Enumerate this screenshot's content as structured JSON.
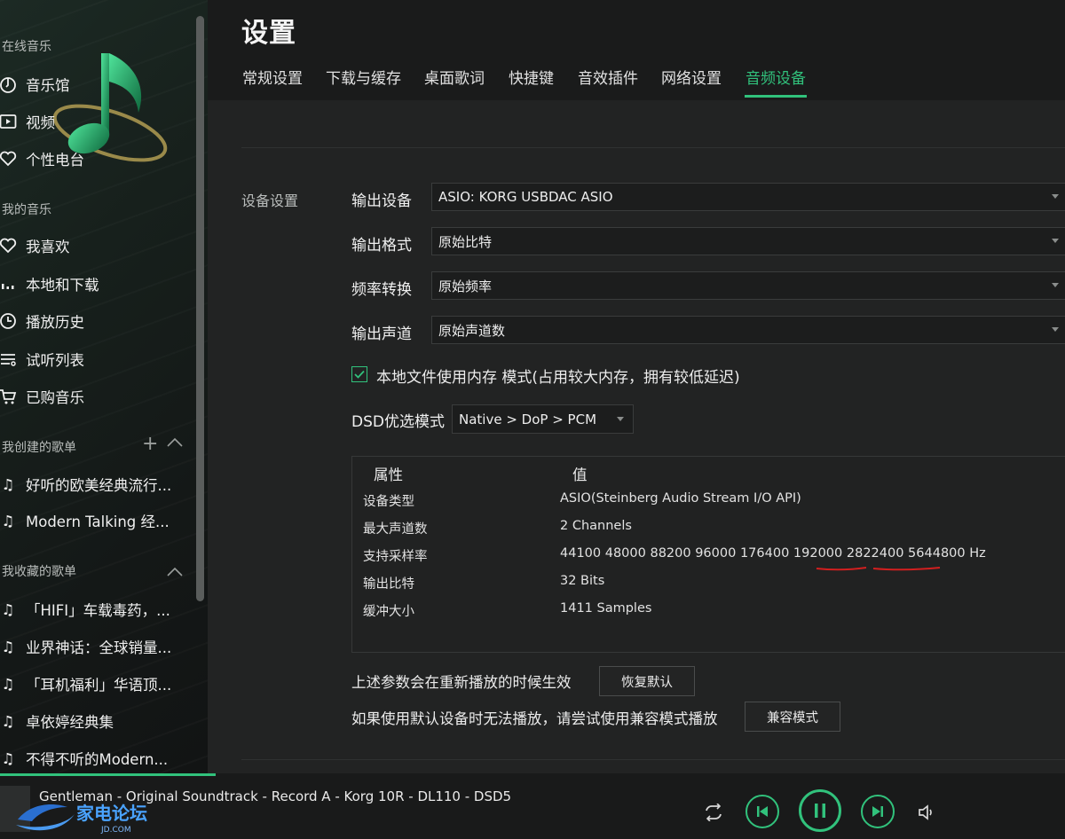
{
  "sidebar": {
    "online_section": "在线音乐",
    "my_music_section": "我的音乐",
    "created_section": "我创建的歌单",
    "collected_section": "我收藏的歌单",
    "online_items": [
      {
        "label": "音乐馆",
        "icon": "music-hall-icon"
      },
      {
        "label": "视频",
        "icon": "video-icon"
      },
      {
        "label": "个性电台",
        "icon": "radio-icon"
      }
    ],
    "my_items": [
      {
        "label": "我喜欢",
        "icon": "heart-icon"
      },
      {
        "label": "本地和下载",
        "icon": "download-bars-icon"
      },
      {
        "label": "播放历史",
        "icon": "clock-icon"
      },
      {
        "label": "试听列表",
        "icon": "list-icon"
      },
      {
        "label": "已购音乐",
        "icon": "cart-icon"
      }
    ],
    "created_playlists": [
      "好听的欧美经典流行...",
      "Modern Talking 经..."
    ],
    "collected_playlists": [
      "「HIFI」车载毒药，...",
      "业界神话：全球销量...",
      "「耳机福利」华语顶...",
      "卓依婷经典集",
      "不得不听的Modern..."
    ]
  },
  "header": {
    "title": "设置",
    "tabs": [
      "常规设置",
      "下载与缓存",
      "桌面歌词",
      "快捷键",
      "音效插件",
      "网络设置",
      "音频设备"
    ],
    "active_tab": "音频设备"
  },
  "device": {
    "section_label": "设备设置",
    "fields": [
      {
        "label": "输出设备",
        "value": "ASIO: KORG USBDAC ASIO"
      },
      {
        "label": "输出格式",
        "value": "原始比特"
      },
      {
        "label": "频率转换",
        "value": "原始频率"
      },
      {
        "label": "输出声道",
        "value": "原始声道数"
      }
    ],
    "memory_mode_label": "本地文件使用内存 模式(占用较大内存，拥有较低延迟)",
    "memory_mode_checked": true,
    "dsd_label": "DSD优选模式",
    "dsd_value": "Native > DoP > PCM"
  },
  "properties": {
    "col_property": "属性",
    "col_value": "值",
    "rows": [
      {
        "key": "设备类型",
        "value": "ASIO(Steinberg Audio Stream I/O API)"
      },
      {
        "key": "最大声道数",
        "value": "2 Channels"
      },
      {
        "key": "支持采样率",
        "value": "44100 48000 88200 96000 176400 192000 2822400 5644800 Hz"
      },
      {
        "key": "输出比特",
        "value": "32 Bits"
      },
      {
        "key": "缓冲大小",
        "value": "1411 Samples"
      }
    ]
  },
  "footer_notes": {
    "restart_note": "上述参数会在重新播放的时候生效",
    "restore_button": "恢复默认",
    "compat_note": "如果使用默认设备时无法播放，请尝试使用兼容模式播放",
    "compat_button": "兼容模式"
  },
  "player": {
    "now_playing": "Gentleman - Original Soundtrack - Record A - Korg 10R - DL110 - DSD5",
    "watermark_text": "家电论坛",
    "watermark_sub": "JD.COM",
    "progress": 0.2,
    "accent_color": "#31c27c"
  }
}
